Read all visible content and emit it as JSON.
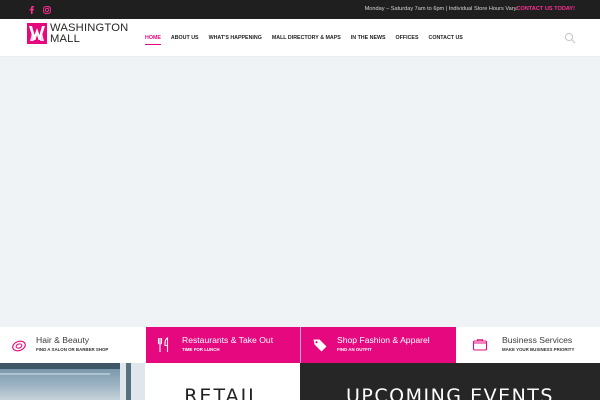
{
  "topbar": {
    "social_icons": [
      "facebook-icon",
      "instagram-icon"
    ],
    "hours": "Monday – Saturday 7am to 6pm | Individual Store Hours Vary/",
    "contact_link": "CONTACT US TODAY!"
  },
  "brand": {
    "line1": "WASHINGTON",
    "line2": "MALL"
  },
  "nav": {
    "items": [
      {
        "label": "HOME",
        "active": true
      },
      {
        "label": "ABOUT US"
      },
      {
        "label": "WHAT'S HAPPENING"
      },
      {
        "label": "MALL DIRECTORY & MAPS"
      },
      {
        "label": "IN THE NEWS"
      },
      {
        "label": "OFFICES"
      },
      {
        "label": "CONTACT US"
      }
    ],
    "search_icon": "search-icon"
  },
  "services": [
    {
      "title": "Hair & Beauty",
      "subtitle": "FIND A SALON OR BARBER SHOP",
      "icon": "beauty-icon"
    },
    {
      "title": "Restaurants & Take Out",
      "subtitle": "TIME FOR LUNCH",
      "icon": "utensils-icon"
    },
    {
      "title": "Shop Fashion & Apparel",
      "subtitle": "FIND AN OUTFIT",
      "icon": "tag-icon"
    },
    {
      "title": "Business Services",
      "subtitle": "MAKE YOUR BUSINESS PRIORITY",
      "icon": "folder-icon"
    }
  ],
  "sections": {
    "retail": "RETAIL",
    "events": "UPCOMING EVENTS"
  },
  "colors": {
    "accent": "#e5087e",
    "topbar_bg": "#1f1f1f",
    "hero_bg": "#f0f3f5",
    "events_bg": "#262626"
  }
}
